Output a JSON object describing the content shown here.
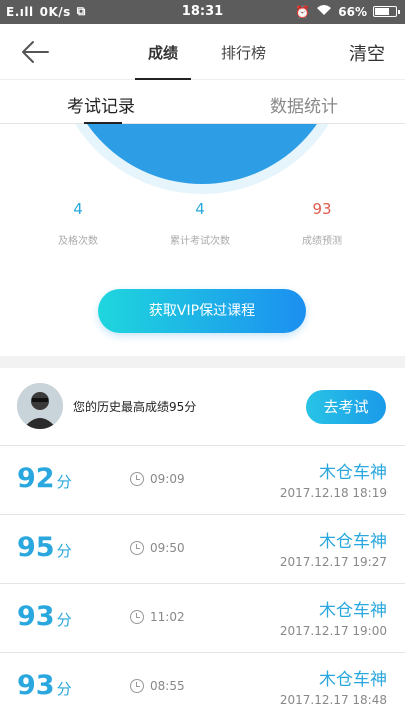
{
  "status_bar": {
    "signal": "E.ıll",
    "speed": "0K/s",
    "time": "18:31",
    "battery": "66%"
  },
  "header": {
    "tabs": [
      {
        "label": "成绩",
        "active": true
      },
      {
        "label": "排行榜",
        "active": false
      }
    ],
    "clear_label": "清空"
  },
  "sub_tabs": [
    {
      "label": "考试记录",
      "active": true
    },
    {
      "label": "数据统计",
      "active": false
    }
  ],
  "stats": [
    {
      "value": "4",
      "label": "及格次数"
    },
    {
      "value": "4",
      "label": "累计考试次数"
    },
    {
      "value": "93",
      "label": "成绩预测"
    }
  ],
  "vip_button": "获取VIP保过课程",
  "best": {
    "text": "您的历史最高成绩95分",
    "button": "去考试"
  },
  "records": [
    {
      "score": "92",
      "unit": "分",
      "duration": "09:09",
      "name": "木仓车神",
      "date": "2017.12.18  18:19"
    },
    {
      "score": "95",
      "unit": "分",
      "duration": "09:50",
      "name": "木仓车神",
      "date": "2017.12.17  19:27"
    },
    {
      "score": "93",
      "unit": "分",
      "duration": "11:02",
      "name": "木仓车神",
      "date": "2017.12.17  19:00"
    },
    {
      "score": "93",
      "unit": "分",
      "duration": "08:55",
      "name": "木仓车神",
      "date": "2017.12.17  18:48"
    }
  ],
  "colors": {
    "accent": "#2aa7de",
    "prediction": "#e05a4e",
    "gauge": "#2d9ee6"
  }
}
